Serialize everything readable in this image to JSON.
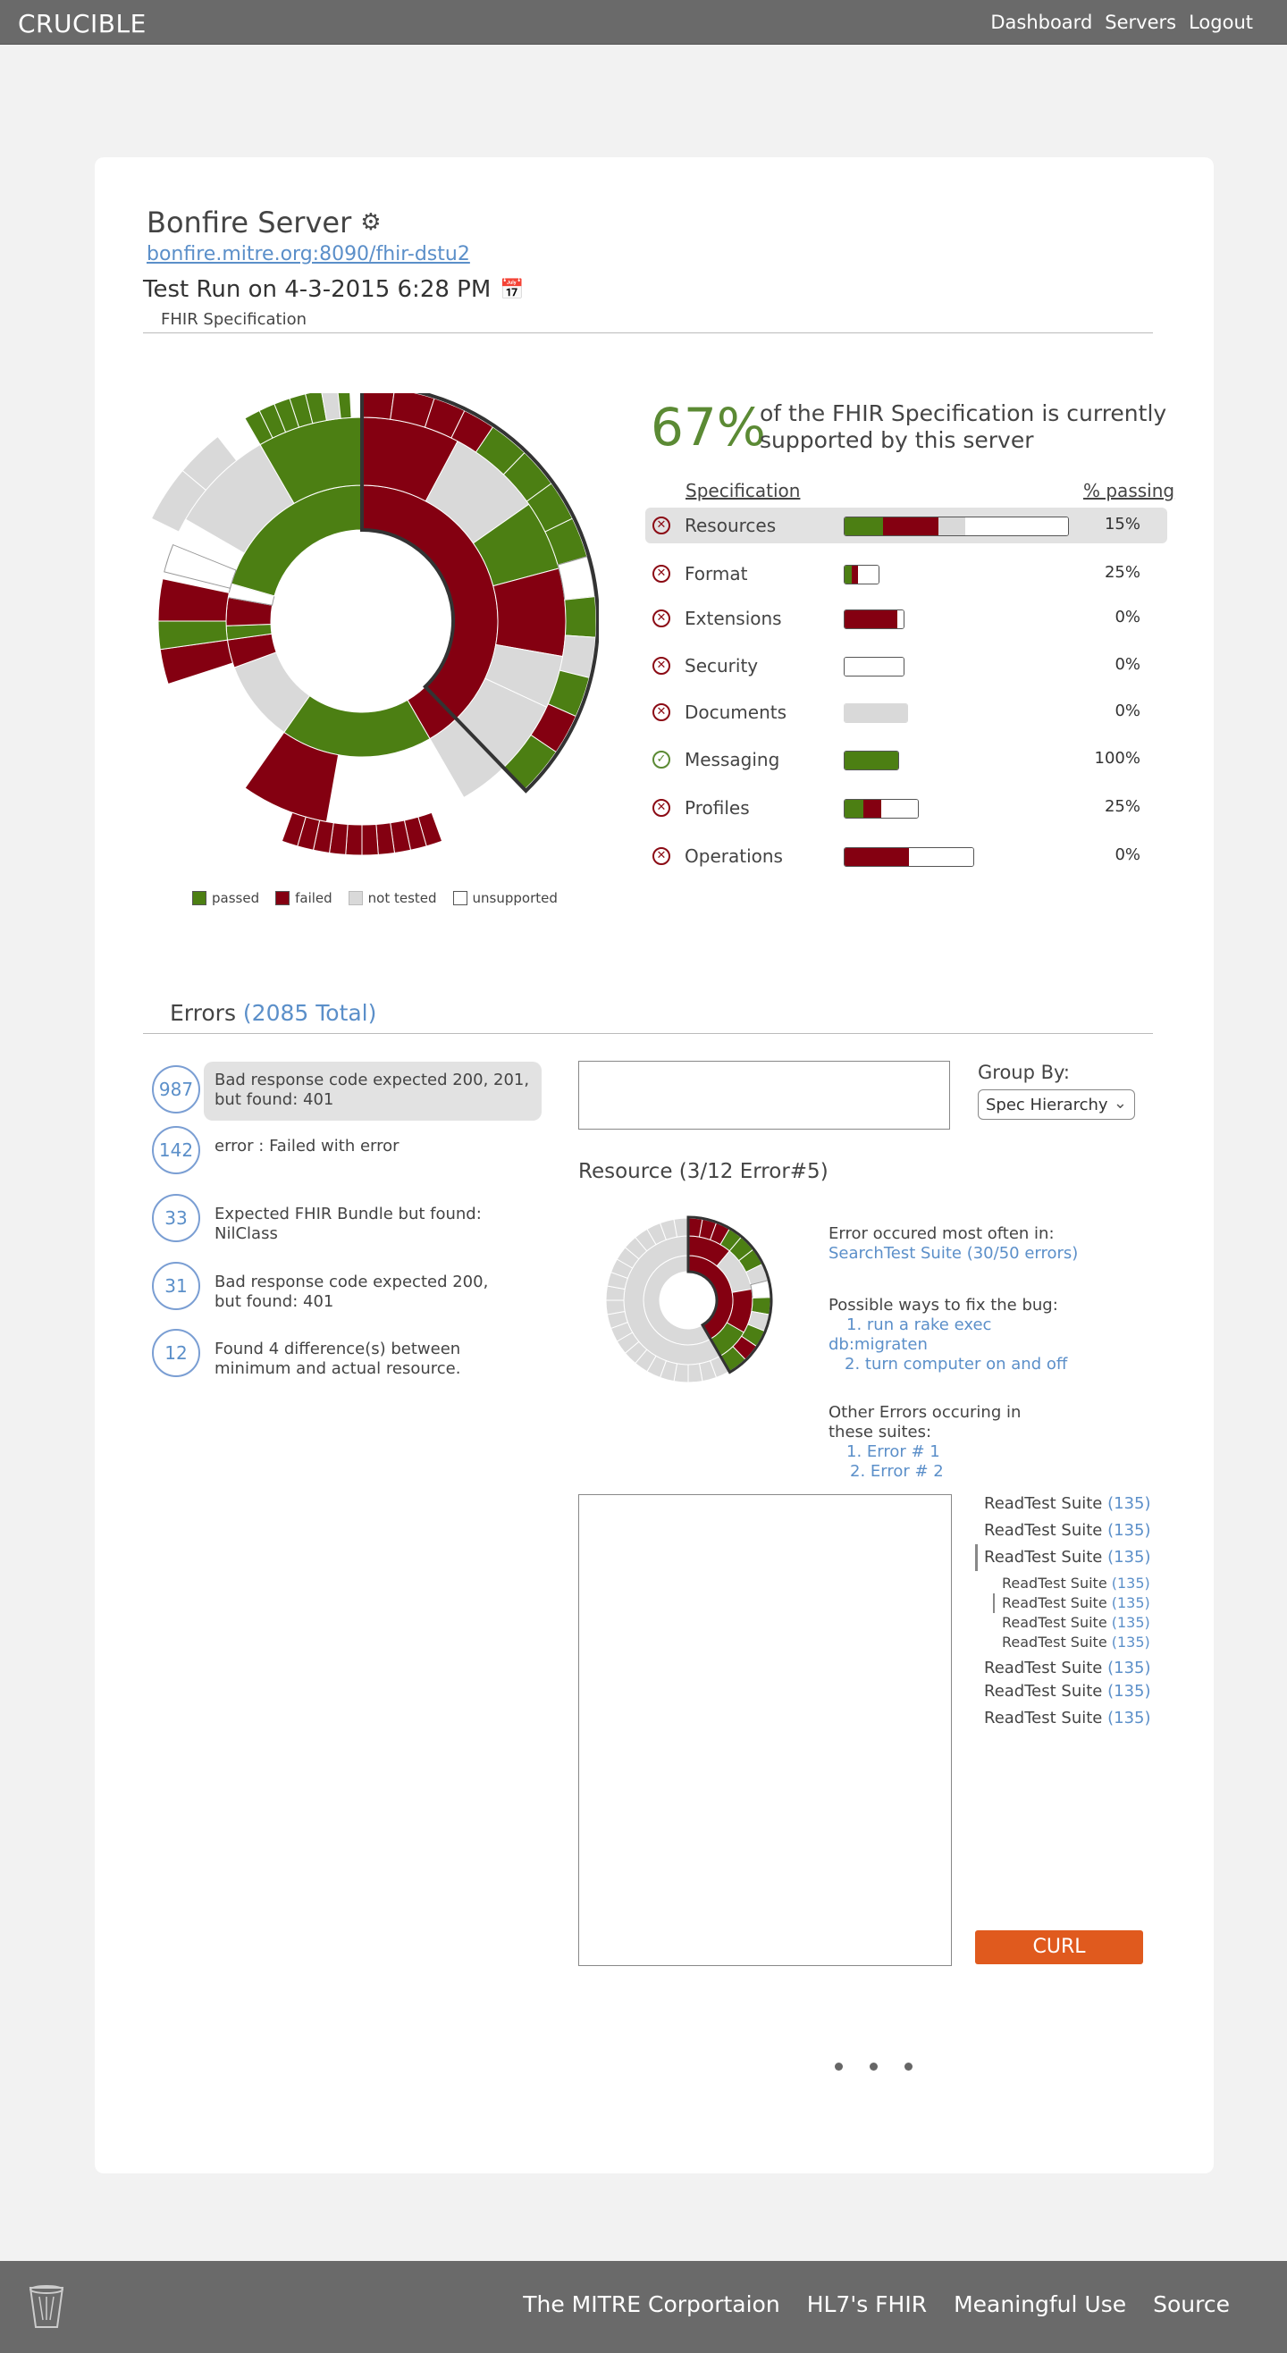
{
  "app": {
    "brand": "CRUCIBLE"
  },
  "nav": {
    "items": [
      "Dashboard",
      "Servers",
      "Logout"
    ]
  },
  "server": {
    "name": "Bonfire Server",
    "url": "bonfire.mitre.org:8090/fhir-dstu2",
    "test_run": "Test Run on 4-3-2015 6:28 PM",
    "spec_label": "FHIR Specification"
  },
  "summary": {
    "percent": "67%",
    "text": "of the FHIR Specification is currently supported by this server"
  },
  "spec_table": {
    "header_spec": "Specification",
    "header_pass": "% passing",
    "rows": [
      {
        "name": "Resources",
        "pct": "15%",
        "status": "fail",
        "passed": 0.17,
        "failed": 0.25,
        "not_tested": 0.12,
        "unsupported": 0.46
      },
      {
        "name": "Format",
        "pct": "25%",
        "status": "fail",
        "passed": 0.2,
        "failed": 0.2,
        "not_tested": 0,
        "unsupported": 0.6
      },
      {
        "name": "Extensions",
        "pct": "0%",
        "status": "fail",
        "passed": 0,
        "failed": 0.9,
        "not_tested": 0,
        "unsupported": 0.1
      },
      {
        "name": "Security",
        "pct": "0%",
        "status": "fail",
        "passed": 0,
        "failed": 0,
        "not_tested": 0,
        "unsupported": 1
      },
      {
        "name": "Documents",
        "pct": "0%",
        "status": "fail",
        "passed": 0,
        "failed": 0,
        "not_tested": 1,
        "unsupported": 0
      },
      {
        "name": "Messaging",
        "pct": "100%",
        "status": "pass",
        "passed": 1,
        "failed": 0,
        "not_tested": 0,
        "unsupported": 0
      },
      {
        "name": "Profiles",
        "pct": "25%",
        "status": "fail",
        "passed": 0.25,
        "failed": 0.25,
        "not_tested": 0,
        "unsupported": 0.5
      },
      {
        "name": "Operations",
        "pct": "0%",
        "status": "fail",
        "passed": 0,
        "failed": 0.5,
        "not_tested": 0,
        "unsupported": 0.5
      }
    ]
  },
  "legend": [
    "passed",
    "failed",
    "not tested",
    "unsupported"
  ],
  "colors": {
    "passed": "#4c7f13",
    "failed": "#840011",
    "not_tested": "#d9d9d9",
    "unsupported": "#ffffff"
  },
  "errors": {
    "title": "Errors",
    "total": "(2085 Total)",
    "items": [
      {
        "count": "987",
        "text": "Bad response code expected 200, 201, but found: 401"
      },
      {
        "count": "142",
        "text": "error : Failed with error"
      },
      {
        "count": "33",
        "text": "Expected FHIR Bundle but found: NilClass"
      },
      {
        "count": "31",
        "text": "Bad response code expected 200, but found: 401"
      },
      {
        "count": "12",
        "text": "Found 4 difference(s) between minimum and actual resource."
      }
    ]
  },
  "group_by": {
    "label": "Group By:",
    "value": "Spec Hierarchy"
  },
  "resource": {
    "title": "Resource (3/12 Error#5)",
    "often_label": "Error occured most often in:",
    "often_value": "SearchTest Suite (30/50 errors)",
    "fix_label": "Possible ways to fix the bug:",
    "fix_1": "1. run a rake exec db:migraten",
    "fix_2": "2. turn computer on and off",
    "other_label": "Other Errors occuring in these suites:",
    "other_1": "1. Error # 1",
    "other_2": "2. Error # 2"
  },
  "suites": [
    {
      "name": "ReadTest Suite",
      "count": "(135)"
    },
    {
      "name": "ReadTest Suite",
      "count": "(135)"
    },
    {
      "name": "ReadTest Suite",
      "count": "(135)"
    },
    {
      "name": "ReadTest Suite",
      "count": "(135)"
    },
    {
      "name": "ReadTest Suite",
      "count": "(135)"
    },
    {
      "name": "ReadTest Suite",
      "count": "(135)"
    },
    {
      "name": "ReadTest Suite",
      "count": "(135)"
    },
    {
      "name": "ReadTest Suite",
      "count": "(135)"
    },
    {
      "name": "ReadTest Suite",
      "count": "(135)"
    },
    {
      "name": "ReadTest Suite",
      "count": "(135)"
    }
  ],
  "curl_label": "CURL",
  "footer": {
    "items": [
      "The MITRE Corportaion",
      "HL7's FHIR",
      "Meaningful Use",
      "Source"
    ]
  }
}
